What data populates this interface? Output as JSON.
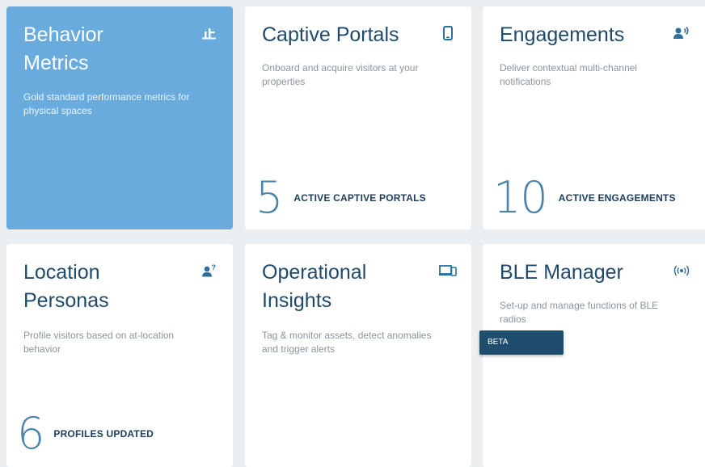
{
  "colors": {
    "active_card": "#6aabdd",
    "title": "#1f4a6b",
    "description": "#8a959e",
    "stat_number": "#2c6e9b",
    "stat_label": "#1c3d5a",
    "beta_badge": "#1f4d6e"
  },
  "cards": [
    {
      "title_line1": "Behavior",
      "title_line2": "Metrics",
      "description": "Gold standard performance metrics for physical spaces",
      "icon": "bar-chart-icon",
      "selected": true
    },
    {
      "title_line1": "Captive Portals",
      "description": "Onboard and acquire visitors at your properties",
      "icon": "mobile-phone-icon",
      "stat_value": "5",
      "stat_label": "ACTIVE CAPTIVE PORTALS"
    },
    {
      "title_line1": "Engagements",
      "description": "Deliver contextual multi-channel notifications",
      "icon": "person-broadcast-icon",
      "stat_value": "10",
      "stat_label": "ACTIVE ENGAGEMENTS"
    },
    {
      "title_line1": "Location",
      "title_line2": "Personas",
      "description": "Profile visitors based on at-location behavior",
      "icon": "person-question-icon",
      "stat_value": "6",
      "stat_label": "PROFILES UPDATED"
    },
    {
      "title_line1": "Operational",
      "title_line2": "Insights",
      "description": "Tag & monitor assets, detect anomalies and trigger alerts",
      "icon": "devices-icon"
    },
    {
      "title_line1": "BLE Manager",
      "description": "Set-up and manage functions of BLE radios",
      "icon": "radio-signal-icon",
      "badge": "BETA"
    }
  ]
}
